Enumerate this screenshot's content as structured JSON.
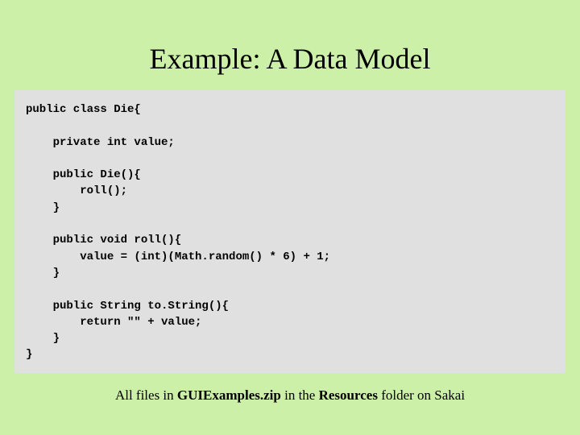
{
  "title": "Example: A Data Model",
  "code": "public class Die{\n\n    private int value;\n\n    public Die(){\n        roll();\n    }\n\n    public void roll(){\n        value = (int)(Math.random() * 6) + 1;\n    }\n\n    public String to.String(){\n        return \"\" + value;\n    }\n}",
  "footer_prefix": "All files in ",
  "footer_file": "GUIExamples.zip",
  "footer_mid": " in the ",
  "footer_folder": "Resources",
  "footer_suffix": " folder on Sakai"
}
